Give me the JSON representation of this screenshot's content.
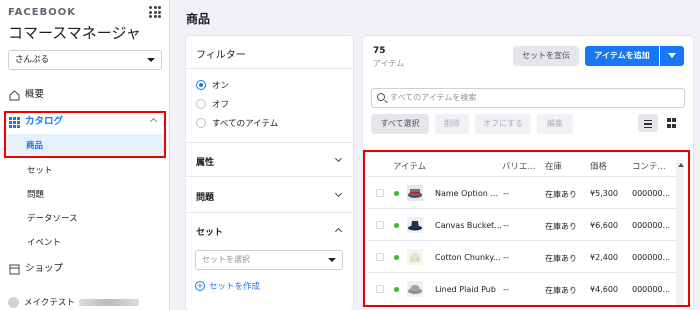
{
  "sidebar": {
    "brand": "FACEBOOK",
    "title": "コマースマネージャ",
    "account": "さんぷる",
    "nav": {
      "overview": "概要",
      "catalog": "カタログ",
      "shops": "ショップ"
    },
    "catalog_sub": {
      "products": "商品",
      "sets": "セット",
      "issues": "問題",
      "data_sources": "データソース",
      "events": "イベント"
    },
    "user": "メイクテスト"
  },
  "page": {
    "title": "商品"
  },
  "filter": {
    "heading": "フィルター",
    "options": [
      "オン",
      "オフ",
      "すべてのアイテム"
    ],
    "selected": "オン",
    "sections": {
      "attributes": "属性",
      "issues": "問題",
      "sets": "セット"
    },
    "set_placeholder": "セットを選択",
    "create_set": "セットを作成"
  },
  "main": {
    "count": "75",
    "count_label": "アイテム",
    "promote_set": "セットを宣伝",
    "add_items": "アイテムを追加",
    "search_placeholder": "すべてのアイテムを検索",
    "select_all": "すべて選択",
    "delete": "削除",
    "turn_off": "オフにする",
    "edit": "編集"
  },
  "table": {
    "headers": [
      "アイテム",
      "バリエ...",
      "在庫",
      "価格",
      "コンテ..."
    ],
    "rows": [
      {
        "name": "Name Option ...",
        "variant": "--",
        "stock": "在庫あり",
        "price": "¥5,300",
        "content": "000000..."
      },
      {
        "name": "Canvas Bucket...",
        "variant": "--",
        "stock": "在庫あり",
        "price": "¥6,600",
        "content": "000000..."
      },
      {
        "name": "Cotton Chunky...",
        "variant": "--",
        "stock": "在庫あり",
        "price": "¥2,400",
        "content": "000000..."
      },
      {
        "name": "Lined Plaid Pub",
        "variant": "--",
        "stock": "在庫あり",
        "price": "¥4,600",
        "content": "000000..."
      }
    ]
  },
  "colors": {
    "accent": "#1877f2",
    "highlight": "#e00000",
    "status_active": "#42b72a"
  }
}
